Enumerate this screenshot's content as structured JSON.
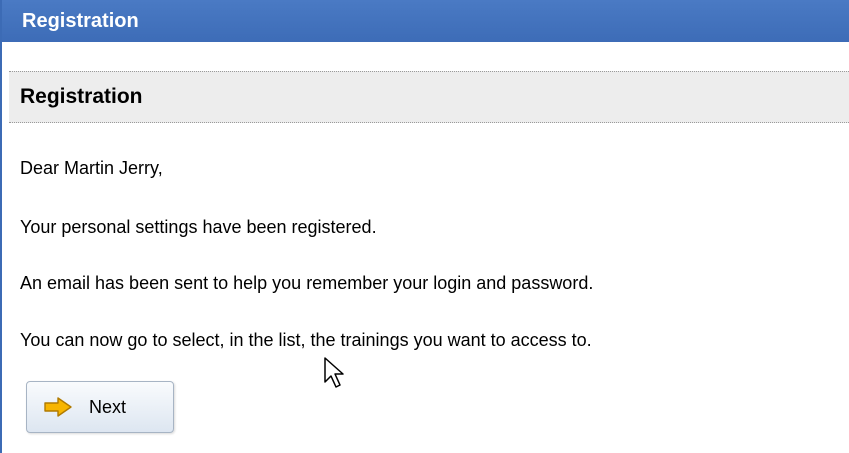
{
  "window": {
    "title": "Registration"
  },
  "section": {
    "title": "Registration"
  },
  "message": {
    "greeting": "Dear Martin Jerry,",
    "line1": "Your personal settings have been registered.",
    "line2": "An email has been sent to help you remember your login and password.",
    "line3": "You can now go to select, in the list, the trainings you want to access to."
  },
  "actions": {
    "next_label": "Next",
    "next_icon": "arrow-right-icon"
  },
  "colors": {
    "titlebar": "#3d6cb7",
    "section_bg": "#ededed",
    "arrow": "#f7b500"
  }
}
